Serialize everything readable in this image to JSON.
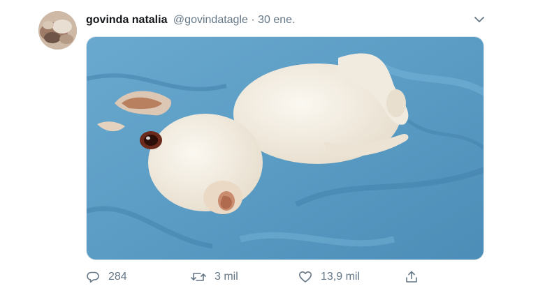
{
  "author": {
    "name": "govinda natalia",
    "handle": "@govindatagle",
    "separator": "·",
    "date": "30 ene."
  },
  "icons": {
    "avatar": "avatar-photo",
    "menu": "chevron-down-icon",
    "reply": "reply-icon",
    "retweet": "retweet-icon",
    "like": "heart-icon",
    "share": "share-icon"
  },
  "stats": {
    "replies": "284",
    "retweets": "3 mil",
    "likes": "13,9 mil"
  },
  "colors": {
    "name": "#14171a",
    "secondary": "#657786",
    "blanket": "#5a9cc4",
    "dog": "#f3efe6"
  }
}
